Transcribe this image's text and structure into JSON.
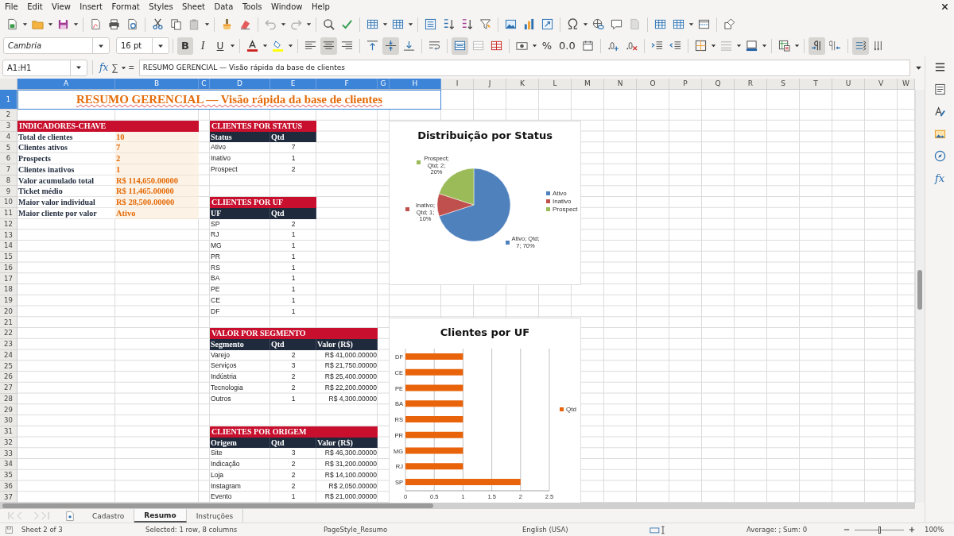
{
  "menu": [
    "File",
    "Edit",
    "View",
    "Insert",
    "Format",
    "Styles",
    "Sheet",
    "Data",
    "Tools",
    "Window",
    "Help"
  ],
  "format_toolbar": {
    "font": "Cambria",
    "size": "16 pt",
    "toggles": [
      {
        "kind": "bold",
        "label": "B",
        "on": true
      },
      {
        "kind": "italic",
        "label": "I",
        "on": false
      },
      {
        "kind": "underline",
        "label": "U",
        "on": false
      }
    ],
    "horizontal_align": [
      {
        "selected": false
      },
      {
        "selected": true
      },
      {
        "selected": false
      }
    ],
    "vertical_align": [
      {
        "selected": false
      },
      {
        "selected": true
      },
      {
        "selected": false
      }
    ],
    "merge_and_center": true,
    "number_format": [
      "%",
      "0.0"
    ],
    "paragraph_direction": [
      {
        "selected": true
      },
      {
        "selected": false
      }
    ],
    "text_direction": [
      {
        "selected": true
      },
      {
        "selected": false
      }
    ]
  },
  "formula_bar": {
    "name_box": "A1:H1",
    "buttons": [
      "fx",
      "∑",
      "="
    ],
    "content": "RESUMO GERENCIAL — Visão rápida da base de clientes"
  },
  "sheet": {
    "columns": [
      {
        "label": "A",
        "selected": true
      },
      {
        "label": "B",
        "selected": true
      },
      {
        "label": "C",
        "selected": true
      },
      {
        "label": "D",
        "selected": true
      },
      {
        "label": "E",
        "selected": true
      },
      {
        "label": "F",
        "selected": true
      },
      {
        "label": "G",
        "selected": true
      },
      {
        "label": "H",
        "selected": true
      },
      {
        "label": "I",
        "selected": false
      },
      {
        "label": "J",
        "selected": false
      },
      {
        "label": "K",
        "selected": false
      },
      {
        "label": "L",
        "selected": false
      },
      {
        "label": "M",
        "selected": false
      },
      {
        "label": "N",
        "selected": false
      },
      {
        "label": "O",
        "selected": false
      },
      {
        "label": "P",
        "selected": false
      },
      {
        "label": "Q",
        "selected": false
      },
      {
        "label": "R",
        "selected": false
      },
      {
        "label": "S",
        "selected": false
      },
      {
        "label": "T",
        "selected": false
      },
      {
        "label": "U",
        "selected": false
      },
      {
        "label": "V",
        "selected": false
      },
      {
        "label": "W",
        "selected": false
      }
    ],
    "rows": [
      {
        "label": "1",
        "selected": true
      },
      {
        "label": "2",
        "selected": false
      },
      {
        "label": "3",
        "selected": false
      },
      {
        "label": "4",
        "selected": false
      },
      {
        "label": "5",
        "selected": false
      },
      {
        "label": "6",
        "selected": false
      },
      {
        "label": "7",
        "selected": false
      },
      {
        "label": "8",
        "selected": false
      },
      {
        "label": "9",
        "selected": false
      },
      {
        "label": "10",
        "selected": false
      },
      {
        "label": "11",
        "selected": false
      },
      {
        "label": "12",
        "selected": false
      },
      {
        "label": "13",
        "selected": false
      },
      {
        "label": "14",
        "selected": false
      },
      {
        "label": "15",
        "selected": false
      },
      {
        "label": "16",
        "selected": false
      },
      {
        "label": "17",
        "selected": false
      },
      {
        "label": "18",
        "selected": false
      },
      {
        "label": "19",
        "selected": false
      },
      {
        "label": "20",
        "selected": false
      },
      {
        "label": "21",
        "selected": false
      },
      {
        "label": "22",
        "selected": false
      },
      {
        "label": "23",
        "selected": false
      },
      {
        "label": "24",
        "selected": false
      },
      {
        "label": "25",
        "selected": false
      },
      {
        "label": "26",
        "selected": false
      },
      {
        "label": "27",
        "selected": false
      },
      {
        "label": "28",
        "selected": false
      },
      {
        "label": "29",
        "selected": false
      },
      {
        "label": "30",
        "selected": false
      },
      {
        "label": "31",
        "selected": false
      },
      {
        "label": "32",
        "selected": false
      },
      {
        "label": "33",
        "selected": false
      },
      {
        "label": "34",
        "selected": false
      },
      {
        "label": "35",
        "selected": false
      },
      {
        "label": "36",
        "selected": false
      },
      {
        "label": "37",
        "selected": false
      }
    ],
    "title": "RESUMO GERENCIAL — Visão rápida da base de clientes",
    "kpi": {
      "title": "INDICADORES-CHAVE",
      "rows": [
        {
          "label": "Total de clientes",
          "value": "10"
        },
        {
          "label": "Clientes ativos",
          "value": "7"
        },
        {
          "label": "Prospects",
          "value": "2"
        },
        {
          "label": "Clientes inativos",
          "value": "1"
        },
        {
          "label": "Valor acumulado total",
          "value": "R$ 114,650.00000"
        },
        {
          "label": "Ticket médio",
          "value": "R$ 11,465.00000"
        },
        {
          "label": "Maior valor individual",
          "value": "R$ 28,500.00000"
        },
        {
          "label": "Maior cliente por valor",
          "value": "Ativo"
        }
      ]
    },
    "tables": [
      {
        "title": "CLIENTES POR STATUS",
        "columns": [
          "Status",
          "Qtd"
        ],
        "rows": [
          [
            "Ativo",
            "7"
          ],
          [
            "Inativo",
            "1"
          ],
          [
            "Prospect",
            "2"
          ]
        ]
      },
      {
        "title": "CLIENTES POR UF",
        "columns": [
          "UF",
          "Qtd"
        ],
        "rows": [
          [
            "SP",
            "2"
          ],
          [
            "RJ",
            "1"
          ],
          [
            "MG",
            "1"
          ],
          [
            "PR",
            "1"
          ],
          [
            "RS",
            "1"
          ],
          [
            "BA",
            "1"
          ],
          [
            "PE",
            "1"
          ],
          [
            "CE",
            "1"
          ],
          [
            "DF",
            "1"
          ]
        ]
      },
      {
        "title": "VALOR POR SEGMENTO",
        "columns": [
          "Segmento",
          "Qtd",
          "Valor (R$)"
        ],
        "rows": [
          [
            "Varejo",
            "2",
            "R$ 41,000.00000"
          ],
          [
            "Serviços",
            "3",
            "R$ 21,750.00000"
          ],
          [
            "Indústria",
            "2",
            "R$ 25,400.00000"
          ],
          [
            "Tecnologia",
            "2",
            "R$ 22,200.00000"
          ],
          [
            "Outros",
            "1",
            "R$ 4,300.00000"
          ]
        ]
      },
      {
        "title": "CLIENTES POR ORIGEM",
        "columns": [
          "Origem",
          "Qtd",
          "Valor (R$)"
        ],
        "rows": [
          [
            "Site",
            "3",
            "R$ 46,300.00000"
          ],
          [
            "Indicação",
            "2",
            "R$ 31,200.00000"
          ],
          [
            "Loja",
            "2",
            "R$ 14,100.00000"
          ],
          [
            "Instagram",
            "2",
            "R$ 2,050.00000"
          ],
          [
            "Evento",
            "1",
            "R$ 21,000.00000"
          ]
        ]
      }
    ],
    "charts": [
      {
        "chart_data": {
          "type": "pie",
          "title": "Distribuição por Status",
          "categories": [
            "Ativo",
            "Inativo",
            "Prospect"
          ],
          "colors": [
            "#4f81bd",
            "#c0504d",
            "#9bbb59"
          ],
          "legend": "right",
          "series": [
            {
              "values": [
                70,
                10,
                20
              ]
            }
          ],
          "value_labels": [
            "Ativo; Qtd; 7; 70%",
            "Inativo; Qtd; 1; 10%",
            "Prospect; Qtd; 2; 20%"
          ]
        }
      },
      {
        "chart_data": {
          "type": "bar",
          "orientation": "horizontal",
          "title": "Clientes por UF",
          "categories": [
            "DF",
            "CE",
            "PE",
            "BA",
            "RS",
            "PR",
            "MG",
            "RJ",
            "SP"
          ],
          "legend": "right",
          "grid": true,
          "series": [
            {
              "name": "Qtd",
              "color": "#e8630a",
              "values": [
                1,
                1,
                1,
                1,
                1,
                1,
                1,
                1,
                2
              ]
            }
          ],
          "xlim": [
            0,
            2.5
          ],
          "xticks": [
            {
              "value": 0,
              "label": "0"
            },
            {
              "value": 0.5,
              "label": "0.5"
            },
            {
              "value": 1,
              "label": "1"
            },
            {
              "value": 1.5,
              "label": "1.5"
            },
            {
              "value": 2,
              "label": "2"
            },
            {
              "value": 2.5,
              "label": "2.5"
            }
          ]
        }
      }
    ]
  },
  "sheet_tabs": [
    {
      "label": "Cadastro",
      "selected": false
    },
    {
      "label": "Resumo",
      "selected": true
    },
    {
      "label": "Instruções",
      "selected": false
    }
  ],
  "sidebar": {
    "functions": "fx"
  },
  "status_bar": {
    "sheet": "Sheet 2 of 3",
    "selection": "Selected: 1 row, 8 columns",
    "page_style": "PageStyle_Resumo",
    "language": "English (USA)",
    "summary": "Average: ; Sum: 0",
    "zoom_slider": {
      "level": 0.5
    },
    "zoom": "100%"
  }
}
